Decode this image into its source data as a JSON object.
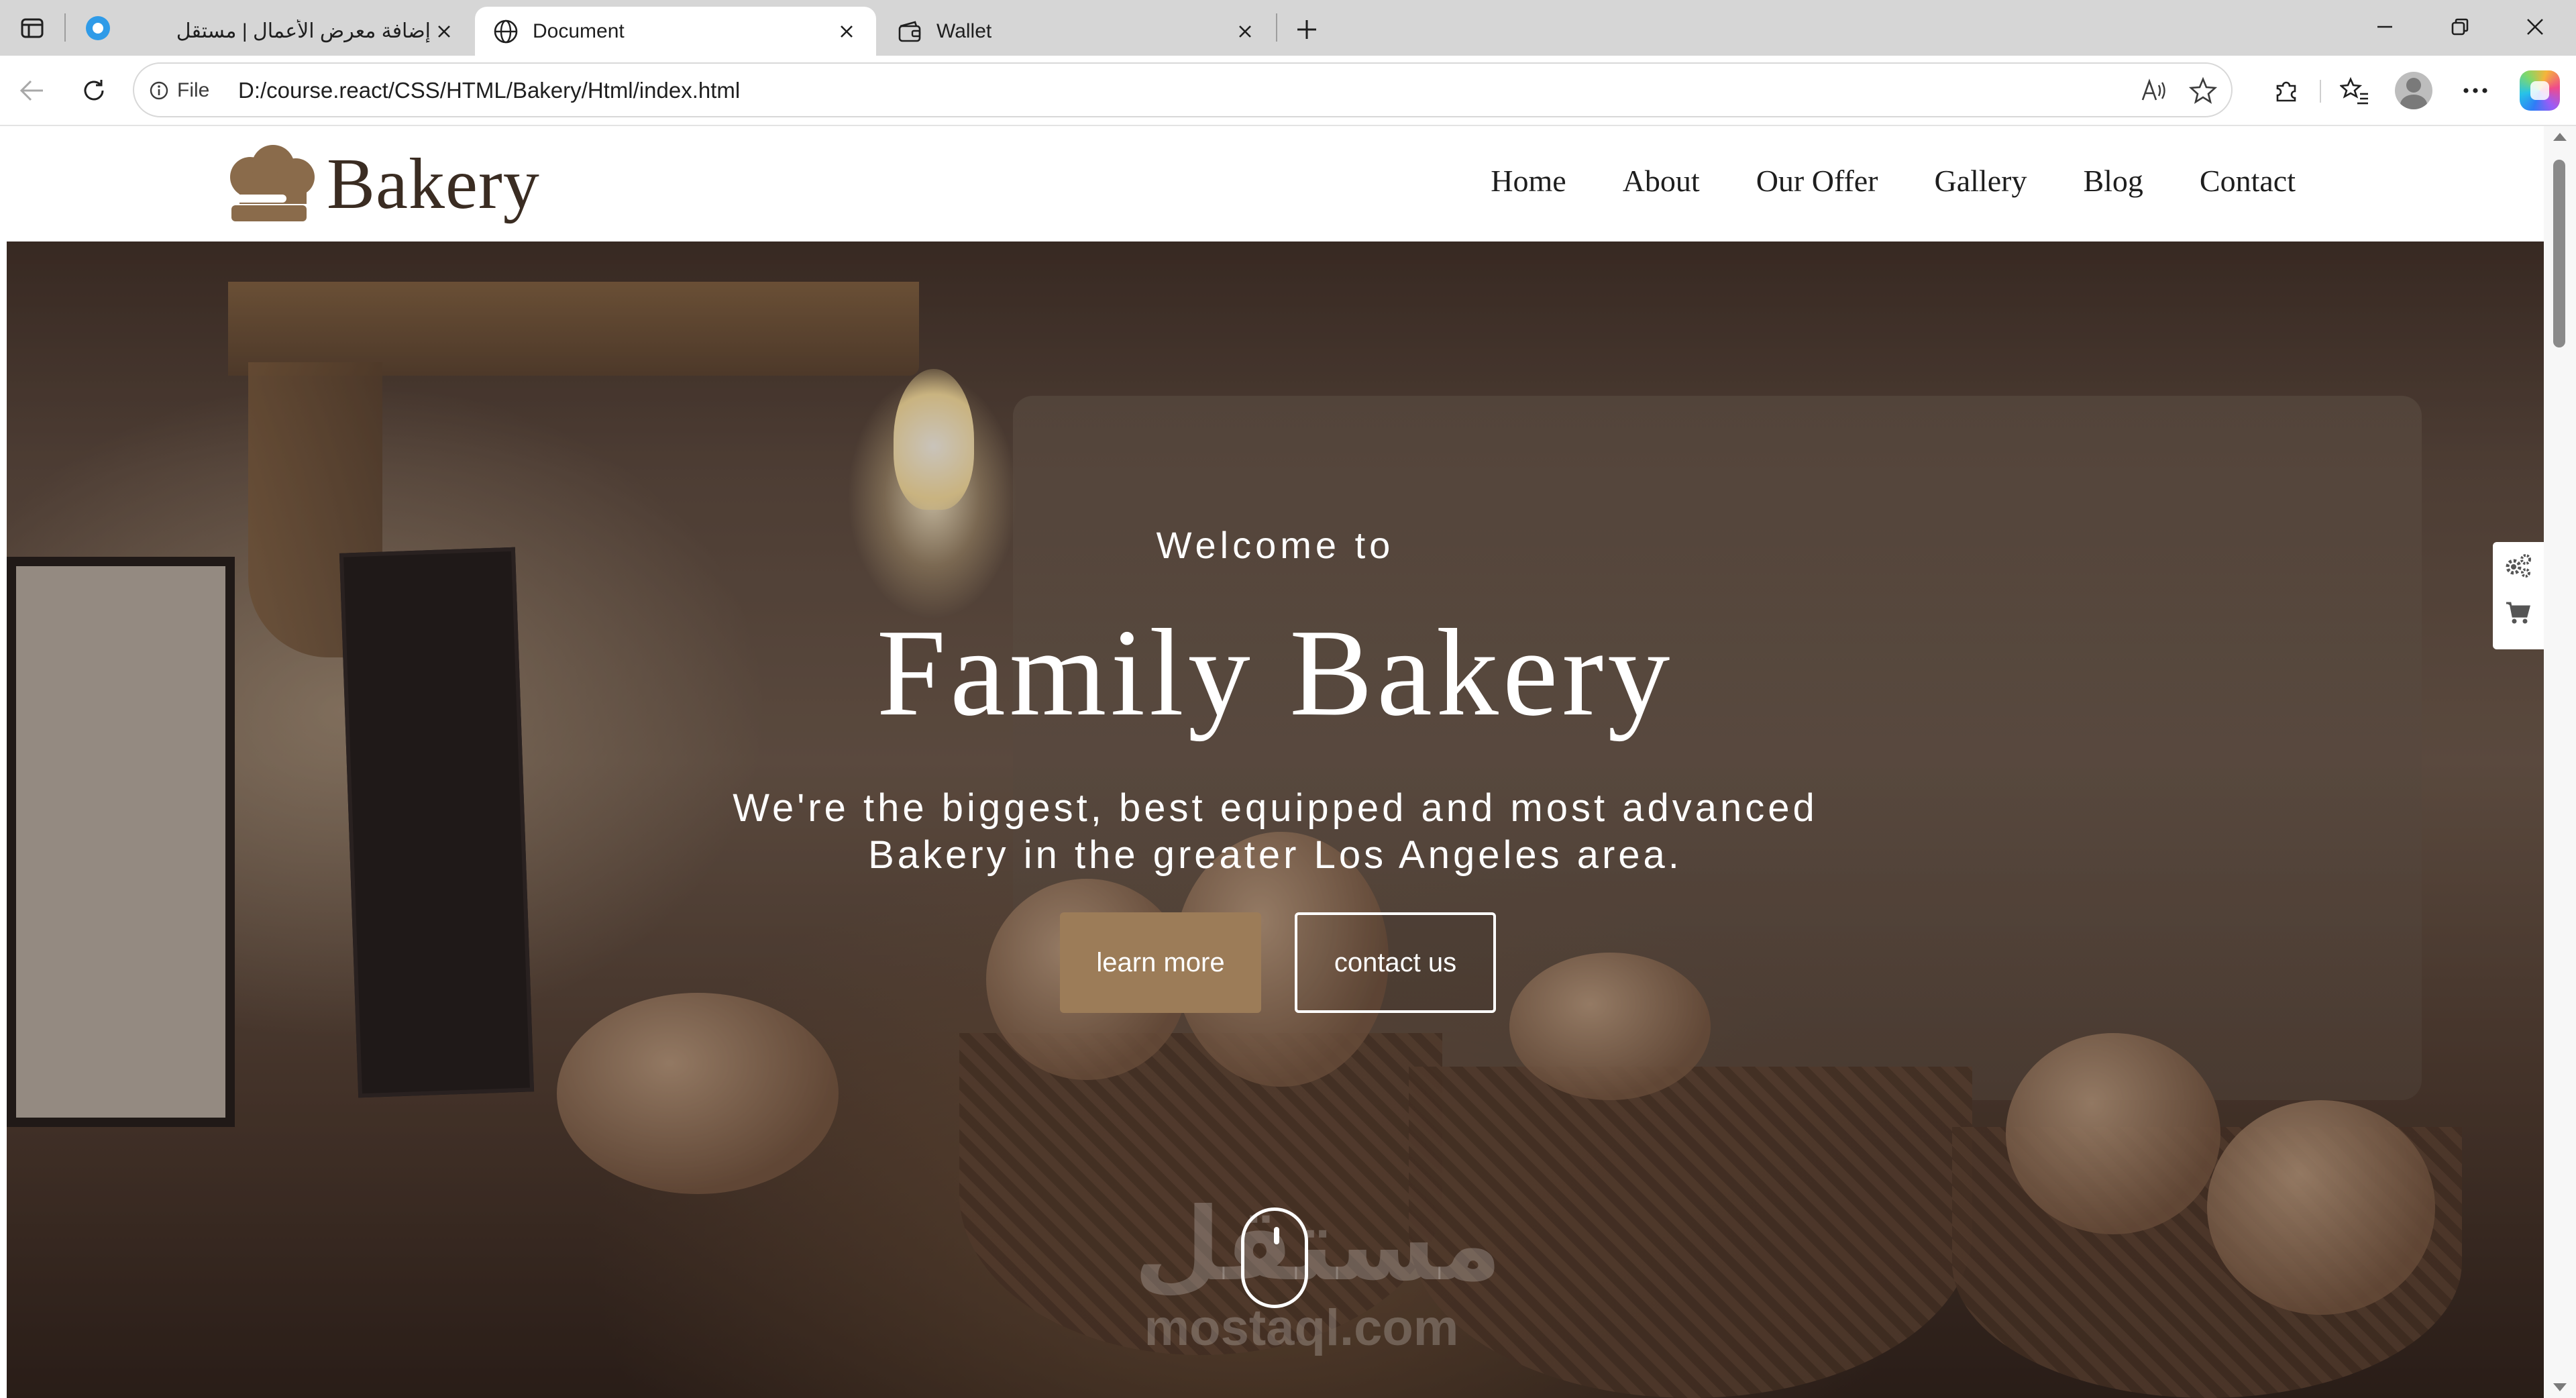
{
  "browser": {
    "tabs": [
      {
        "title": "إضافة معرض الأعمال | مستقل",
        "active": false
      },
      {
        "title": "Document",
        "active": true
      },
      {
        "title": "Wallet",
        "active": false
      }
    ],
    "address": {
      "scheme_label": "File",
      "url": "D:/course.react/CSS/HTML/Bakery/Html/index.html"
    }
  },
  "site": {
    "logo_text": "Bakery",
    "nav": [
      "Home",
      "About",
      "Our Offer",
      "Gallery",
      "Blog",
      "Contact"
    ],
    "hero": {
      "welcome": "Welcome to",
      "title": "Family Bakery",
      "description_line1": "We're the biggest, best equipped and most advanced",
      "description_line2": "Bakery in the greater Los Angeles area.",
      "learn_more": "learn more",
      "contact_us": "contact us"
    },
    "watermark": {
      "arabic": "مستقل",
      "latin": "mostaql.com"
    }
  },
  "colors": {
    "accent_brown": "#9c7c58",
    "logo_brown": "#3a2c22",
    "tabstrip": "#d6d6d6"
  },
  "icons": {
    "tab_actions": "tab-actions-icon",
    "pinned": "edge-circle-icon",
    "document_tab": "globe-icon",
    "wallet_tab": "wallet-icon",
    "side_widget": [
      "gears-icon",
      "cart-icon"
    ]
  }
}
